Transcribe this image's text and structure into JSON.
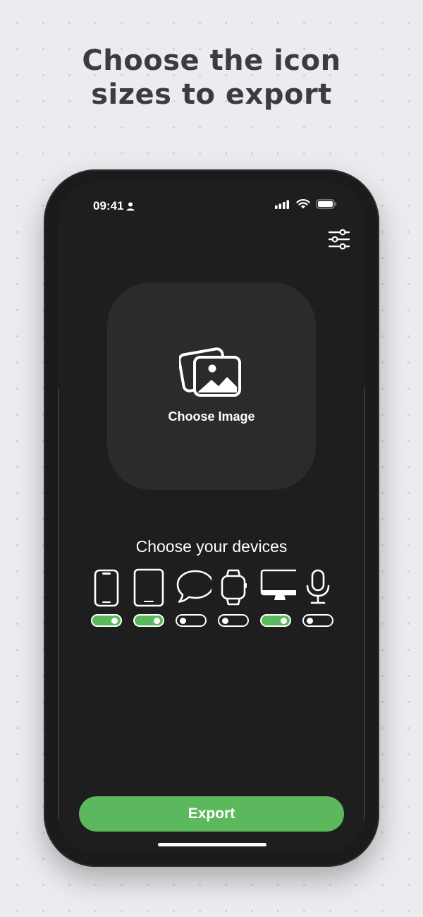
{
  "headline": {
    "line1": "Choose the icon",
    "line2": "sizes to export"
  },
  "status_bar": {
    "time": "09:41",
    "icons": [
      "person-icon",
      "signal-icon",
      "wifi-icon",
      "battery-icon"
    ]
  },
  "toolbar": {
    "settings_icon": "sliders-icon"
  },
  "image_picker": {
    "label": "Choose Image",
    "icon": "photos-icon"
  },
  "devices_section": {
    "title": "Choose your devices",
    "devices": [
      {
        "id": "iphone",
        "icon": "iphone-icon",
        "enabled": true
      },
      {
        "id": "ipad",
        "icon": "ipad-icon",
        "enabled": true
      },
      {
        "id": "imessage",
        "icon": "message-bubble-icon",
        "enabled": false
      },
      {
        "id": "watch",
        "icon": "watch-icon",
        "enabled": false
      },
      {
        "id": "mac",
        "icon": "monitor-icon",
        "enabled": true
      },
      {
        "id": "microphone",
        "icon": "microphone-icon",
        "enabled": false
      }
    ]
  },
  "export_button": {
    "label": "Export"
  },
  "colors": {
    "accent": "#5cb85c",
    "phone_body": "#1b1b1b",
    "card": "#2b2b2b",
    "background": "#ebecef",
    "headline": "#3c3c3e"
  }
}
